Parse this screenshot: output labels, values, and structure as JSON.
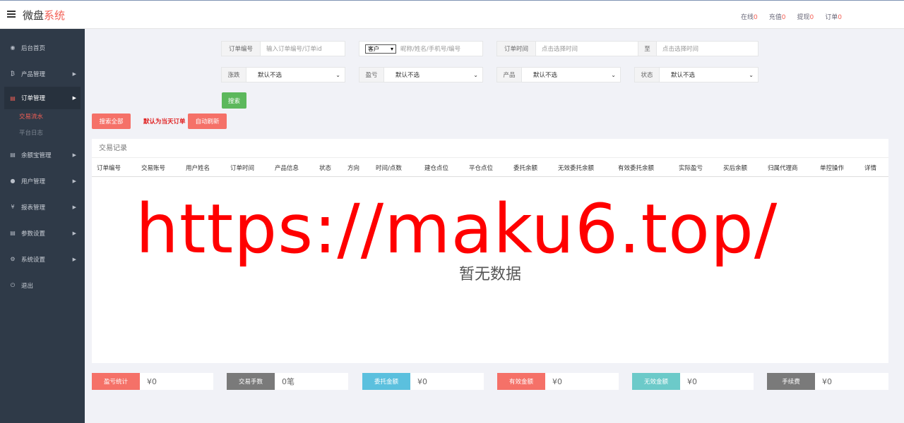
{
  "header": {
    "brand_main": "微盘",
    "brand_accent": "系统",
    "links": [
      {
        "label": "在线",
        "count": "0"
      },
      {
        "label": "充值",
        "count": "0"
      },
      {
        "label": "提现",
        "count": "0"
      },
      {
        "label": "订单",
        "count": "0"
      }
    ]
  },
  "sidebar": {
    "items": [
      {
        "icon": "dashboard-icon",
        "glyph": "◉",
        "label": "后台首页"
      },
      {
        "icon": "bitcoin-icon",
        "glyph": "₿",
        "label": "产品管理"
      },
      {
        "icon": "order-icon",
        "glyph": "▤",
        "label": "订单管理"
      },
      {
        "icon": "wallet-icon",
        "glyph": "▤",
        "label": "余额宝管理"
      },
      {
        "icon": "user-icon",
        "glyph": "●",
        "label": "用户管理"
      },
      {
        "icon": "yen-icon",
        "glyph": "¥",
        "label": "报表管理"
      },
      {
        "icon": "params-icon",
        "glyph": "▤",
        "label": "参数设置"
      },
      {
        "icon": "gear-icon",
        "glyph": "⚙",
        "label": "系统设置"
      },
      {
        "icon": "power-icon",
        "glyph": "⏻",
        "label": "退出"
      }
    ],
    "subitems": [
      "交易流水",
      "平台日志"
    ]
  },
  "filters": {
    "order_no_label": "订单编号",
    "order_no_placeholder": "输入订单编号/订单id",
    "customer_select": "客户",
    "customer_placeholder": "昵称/姓名/手机号/编号",
    "order_time_label": "订单时间",
    "time_from_placeholder": "点击选择时间",
    "to_label": "至",
    "time_to_placeholder": "点击选择时间",
    "rise_fall_label": "涨跌",
    "rise_fall_value": "默认不选",
    "profit_label": "盈亏",
    "profit_value": "默认不选",
    "product_label": "产品",
    "product_value": "默认不选",
    "status_label": "状态",
    "status_value": "默认不选",
    "search_button": "搜索"
  },
  "actions": {
    "search_all": "搜索全部",
    "default_today": "默认为当天订单",
    "auto_refresh": "自动刷新"
  },
  "table": {
    "title": "交易记录",
    "columns": [
      "订单编号",
      "交易账号",
      "用户姓名",
      "订单时间",
      "产品信息",
      "状态",
      "方向",
      "时间/点数",
      "建仓点位",
      "平仓点位",
      "委托余额",
      "无效委托余额",
      "有效委托余额",
      "实际盈亏",
      "买后余额",
      "归属代理商",
      "单控操作",
      "详情"
    ],
    "empty_text": "暂无数据"
  },
  "watermark": "https://maku6.top/",
  "stats": [
    {
      "label": "盈亏统计",
      "value": "¥0",
      "color": "#f57168"
    },
    {
      "label": "交易手数",
      "value": "0笔",
      "color": "#7a7a7a"
    },
    {
      "label": "委托金额",
      "value": "¥0",
      "color": "#5bc0de"
    },
    {
      "label": "有效金额",
      "value": "¥0",
      "color": "#f57168"
    },
    {
      "label": "无效金额",
      "value": "¥0",
      "color": "#6ccac9"
    },
    {
      "label": "手续费",
      "value": "¥0",
      "color": "#7a7a7a"
    }
  ],
  "colors": {
    "accent": "#f35f55",
    "sidebar": "#2f3a48",
    "success": "#5cb85c"
  }
}
